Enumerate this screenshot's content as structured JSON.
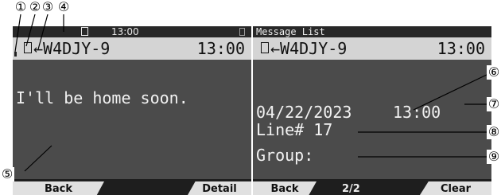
{
  "callouts": {
    "c1": "①",
    "c2": "②",
    "c3": "③",
    "c4": "④",
    "c5": "⑤",
    "c6": "⑥",
    "c7": "⑦",
    "c8": "⑧",
    "c9": "⑨"
  },
  "left_screen": {
    "status_time": "13:00",
    "header_text": "←W4DJY-9",
    "header_time": "13:00",
    "message": "I'll be home soon.",
    "softkeys": {
      "back": "Back",
      "detail": "Detail"
    }
  },
  "right_screen": {
    "title": "Message List",
    "header_text": "←W4DJY-9",
    "header_time": "13:00",
    "date": "04/22/2023",
    "time": "13:00",
    "line_label": "Line# 17",
    "group_label": "Group:",
    "softkeys": {
      "back": "Back",
      "page": "2/2",
      "clear": "Clear"
    }
  },
  "icons": [
    "unread-mark-icon",
    "document-icon",
    "message-icon",
    "battery-icon"
  ]
}
